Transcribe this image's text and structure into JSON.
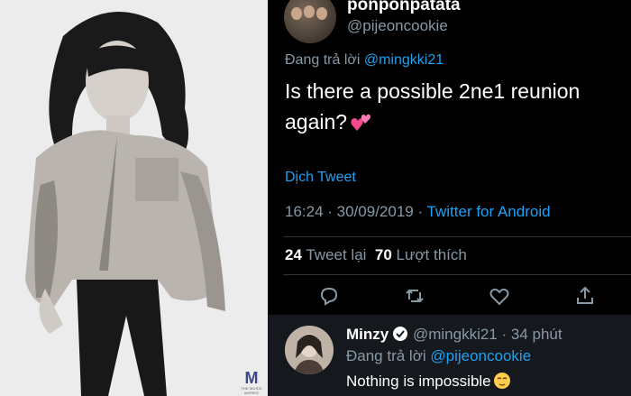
{
  "photo": {
    "watermark_letter": "M",
    "watermark_text": "THE MUSIC WORKS"
  },
  "tweet": {
    "author_name": "ponponpatata",
    "author_handle": "@pijeoncookie",
    "replying_prefix": "Đang trả lời",
    "replying_to": "@mingkki21",
    "text_line1": "Is there a possible 2ne1 reunion",
    "text_line2": "again?",
    "emoji": "two-hearts-icon",
    "translate_label": "Dịch Tweet",
    "timestamp": "16:24 · 30/09/2019 ·",
    "client": "Twitter for Android",
    "retweet_count": "24",
    "retweet_label": "Tweet lại",
    "like_count": "70",
    "like_label": "Lượt thích"
  },
  "reply": {
    "author_name": "Minzy",
    "author_handle": "@mingkki21 · 34 phút",
    "replying_prefix": "Đang trả lời",
    "replying_to": "@pijeoncookie",
    "text": "Nothing is impossible",
    "emoji": "relieved-face-icon"
  },
  "colors": {
    "background": "#000000",
    "link": "#1da1f2",
    "muted": "#8899a6",
    "reply_bg": "#15181c"
  }
}
